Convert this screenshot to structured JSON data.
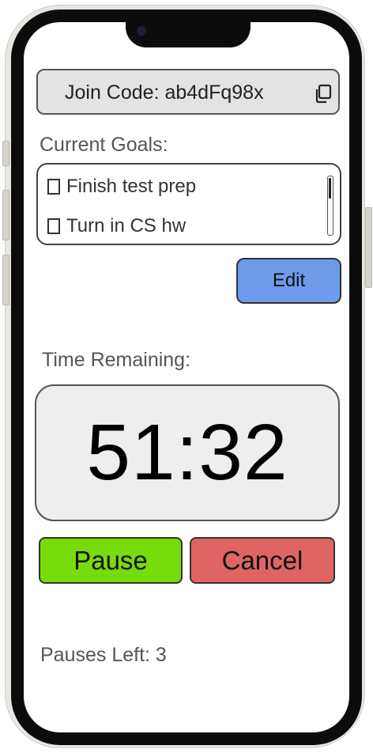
{
  "join": {
    "label": "Join Code: ab4dFq98x",
    "copy_icon": "copy-icon"
  },
  "goals": {
    "title": "Current Goals:",
    "items": [
      {
        "label": "Finish test prep",
        "checked": false
      },
      {
        "label": "Turn in CS hw",
        "checked": false
      }
    ],
    "edit_label": "Edit"
  },
  "timer": {
    "title": "Time Remaining:",
    "value": "51:32"
  },
  "actions": {
    "pause_label": "Pause",
    "cancel_label": "Cancel"
  },
  "pauses_left": "Pauses Left: 3",
  "colors": {
    "edit": "#6e9be9",
    "pause": "#76dc0c",
    "cancel": "#e06464",
    "join_bg": "#e3e3e3",
    "timer_bg": "#eeeeee"
  }
}
